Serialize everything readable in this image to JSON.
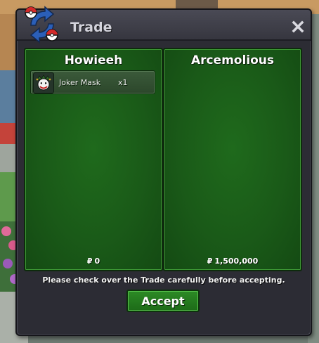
{
  "window": {
    "title": "Trade",
    "icons": {
      "logo": "trade-arrows-pokeball-icon",
      "close": "close-icon"
    }
  },
  "trade": {
    "left": {
      "player_name": "Howieeh",
      "items": [
        {
          "name": "Joker Mask",
          "quantity": "x1",
          "icon": "joker-mask-icon"
        }
      ],
      "currency_symbol": "₽",
      "money": "0"
    },
    "right": {
      "player_name": "Arcemolious",
      "items": [],
      "currency_symbol": "₽",
      "money": "1,500,000"
    }
  },
  "notice": "Please check over the Trade carefully before accepting.",
  "actions": {
    "accept_label": "Accept"
  },
  "colors": {
    "panel_green": "#1a5a18",
    "button_green": "#2c8a25",
    "window_dark": "#2c2c34",
    "title_text": "#d3d3dc"
  }
}
